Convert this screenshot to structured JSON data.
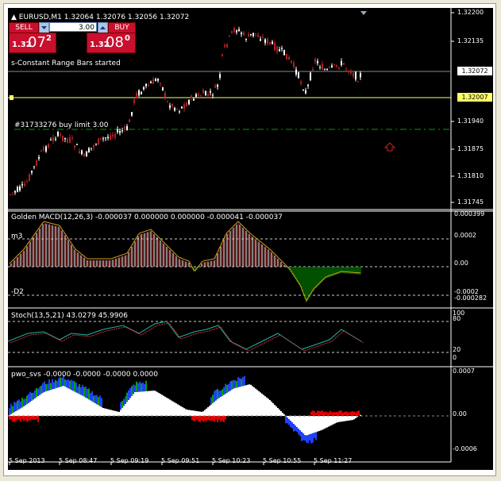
{
  "chart": {
    "header": "EURUSD,M1  1.32064 1.32076 1.32056 1.32072",
    "status": "s-Constant Range Bars started",
    "order_label": "#31733276 buy limit 3.00",
    "price_levels": [
      "1.32200",
      "1.32135",
      "1.32072",
      "1.32007",
      "1.31940",
      "1.31875",
      "1.31810",
      "1.31745"
    ],
    "current_price": "1.32072",
    "line_price": "1.32007"
  },
  "trade_panel": {
    "sell_label": "SELL",
    "buy_label": "BUY",
    "lot": "3.00",
    "sell_price_prefix": "1.32",
    "sell_price_big": "07",
    "sell_price_sup": "2",
    "buy_price_prefix": "1.32",
    "buy_price_big": "08",
    "buy_price_sup": "0"
  },
  "macd": {
    "title": "Golden MACD(12,26,3) -0.000037 0.000000 0.000000 -0.000041 -0.000037",
    "levels": [
      "0.000399",
      "0.0002",
      "0.00",
      "-0.0002",
      "-0.000282"
    ],
    "label_m3": "m3",
    "label_d2": "-D2"
  },
  "stoch": {
    "title": "Stoch(13,5,21) 43.0279 45.9906",
    "levels": [
      "100",
      "80",
      "20",
      "0"
    ]
  },
  "pwo": {
    "title": "pwo_svs -0.0000 -0.0000 -0.0000 0.0000",
    "levels": [
      "0.0007",
      "0.00",
      "-0.0006"
    ]
  },
  "time_axis": [
    "5 Sep 2013",
    "5 Sep 08:47",
    "5 Sep 09:19",
    "5 Sep 09:51",
    "5 Sep 10:23",
    "5 Sep 10:55",
    "5 Sep 11:27"
  ],
  "colors": {
    "bull": "#ffffff",
    "bear": "#b22222",
    "green": "#00a000",
    "grid": "#c0c0c0",
    "yellow": "#ffff66"
  }
}
